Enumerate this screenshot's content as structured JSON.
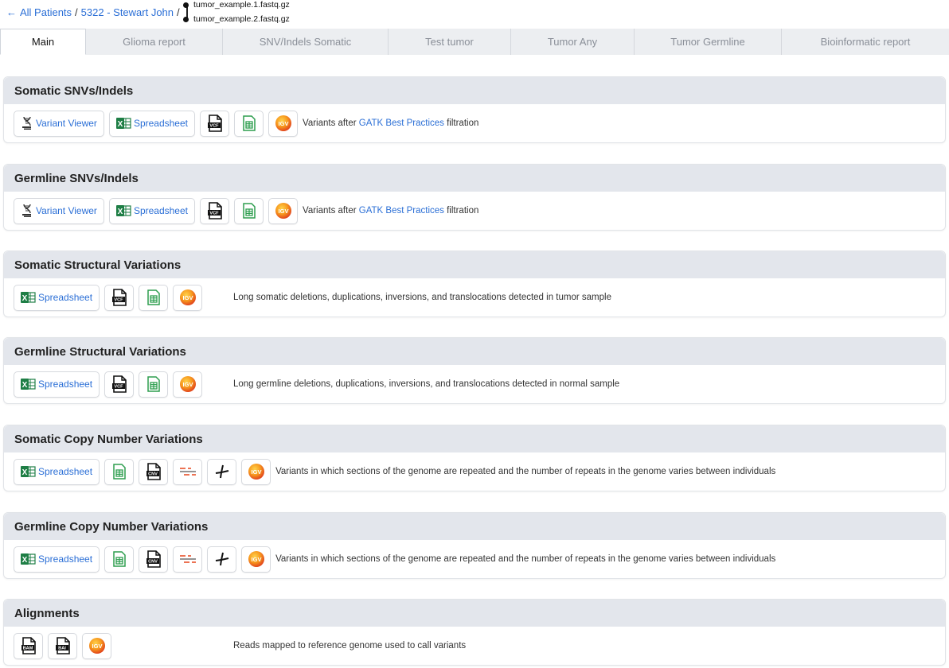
{
  "breadcrumb": {
    "back_arrow": "←",
    "all_patients": "All Patients",
    "sep1": "/",
    "patient": "5322 - Stewart John",
    "sep2": "/"
  },
  "files": [
    "tumor_example.1.fastq.gz",
    "tumor_example.2.fastq.gz"
  ],
  "tabs": [
    "Main",
    "Glioma report",
    "SNV/Indels Somatic",
    "Test tumor",
    "Tumor Any",
    "Tumor Germline",
    "Bioinformatic report"
  ],
  "buttons": {
    "variant_viewer": "Variant Viewer",
    "spreadsheet": "Spreadsheet"
  },
  "icon_text": {
    "vcf": "VCF",
    "cnv": "CNV",
    "bam": "BAM",
    "bai": "BAI",
    "igv": "IGV",
    "excel_x": "X"
  },
  "sections": {
    "somatic_snv": {
      "title": "Somatic SNVs/Indels",
      "desc_pre": "Variants after ",
      "desc_link": "GATK Best Practices",
      "desc_post": " filtration"
    },
    "germline_snv": {
      "title": "Germline SNVs/Indels",
      "desc_pre": "Variants after ",
      "desc_link": "GATK Best Practices",
      "desc_post": " filtration"
    },
    "somatic_sv": {
      "title": "Somatic Structural Variations",
      "desc": "Long somatic deletions, duplications, inversions, and translocations detected in tumor sample"
    },
    "germline_sv": {
      "title": "Germline Structural Variations",
      "desc": "Long germline deletions, duplications, inversions, and translocations detected in normal sample"
    },
    "somatic_cnv": {
      "title": "Somatic Copy Number Variations",
      "desc": "Variants in which sections of the genome are repeated and the number of repeats in the genome varies between individuals"
    },
    "germline_cnv": {
      "title": "Germline Copy Number Variations",
      "desc": "Variants in which sections of the genome are repeated and the number of repeats in the genome varies between individuals"
    },
    "alignments": {
      "title": "Alignments",
      "desc": "Reads mapped to reference genome used to call variants"
    }
  },
  "colors": {
    "link": "#2b6fd6",
    "header_bg": "#e3e6ec",
    "excel_green": "#1e7e45",
    "sheet_green": "#2e9e4f",
    "igv_orange": "#ef6a1f"
  }
}
